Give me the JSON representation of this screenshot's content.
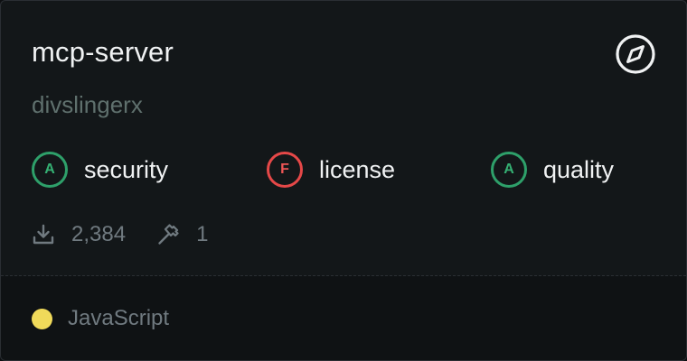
{
  "card": {
    "name": "mcp-server",
    "author": "divslingerx",
    "icon": "compass-icon",
    "scores": [
      {
        "grade": "A",
        "label": "security",
        "color": "#2ea06a"
      },
      {
        "grade": "F",
        "label": "license",
        "color": "#e54848"
      },
      {
        "grade": "A",
        "label": "quality",
        "color": "#2ea06a"
      }
    ],
    "stats": {
      "downloads": "2,384",
      "downloads_icon": "download-icon",
      "tools": "1",
      "tools_icon": "hammer-icon"
    },
    "language": {
      "name": "JavaScript",
      "color": "#f0da5a"
    }
  }
}
